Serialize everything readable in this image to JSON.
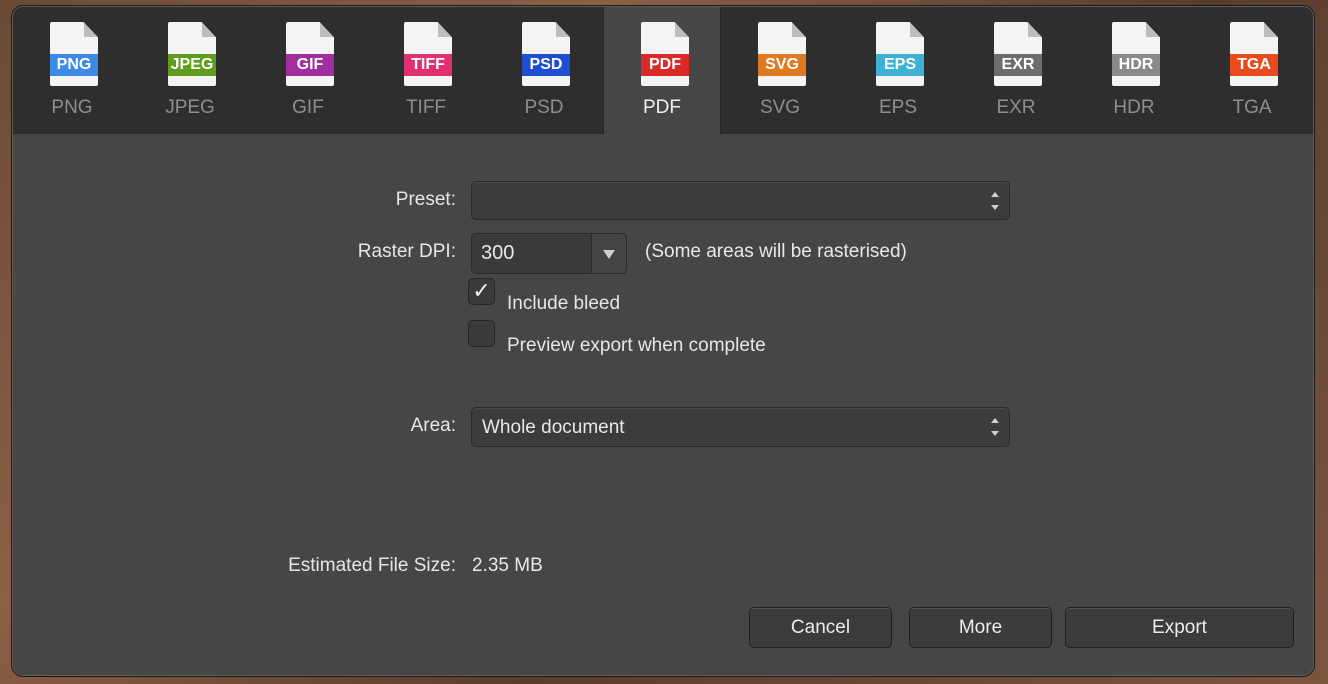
{
  "formats": [
    {
      "tag": "PNG",
      "label": "PNG",
      "color": "#3d8ae6"
    },
    {
      "tag": "JPEG",
      "label": "JPEG",
      "color": "#5f9c1f"
    },
    {
      "tag": "GIF",
      "label": "GIF",
      "color": "#a02e9e"
    },
    {
      "tag": "TIFF",
      "label": "TIFF",
      "color": "#e0306f"
    },
    {
      "tag": "PSD",
      "label": "PSD",
      "color": "#1f4fcf"
    },
    {
      "tag": "PDF",
      "label": "PDF",
      "color": "#d92a28"
    },
    {
      "tag": "SVG",
      "label": "SVG",
      "color": "#e07a20"
    },
    {
      "tag": "EPS",
      "label": "EPS",
      "color": "#3fb0d6"
    },
    {
      "tag": "EXR",
      "label": "EXR",
      "color": "#6d6d6d"
    },
    {
      "tag": "HDR",
      "label": "HDR",
      "color": "#8a8a8a"
    },
    {
      "tag": "TGA",
      "label": "TGA",
      "color": "#e84c1c"
    }
  ],
  "selected_format": "PDF",
  "form": {
    "preset_label": "Preset:",
    "preset_value": "",
    "raster_dpi_label": "Raster DPI:",
    "raster_dpi_value": "300",
    "raster_note": "(Some areas will be rasterised)",
    "include_bleed_label": "Include bleed",
    "include_bleed_checked": true,
    "check_glyph": "✓",
    "preview_label": "Preview export when complete",
    "preview_checked": false,
    "area_label": "Area:",
    "area_value": "Whole document",
    "size_label": "Estimated File Size:",
    "size_value": "2.35 MB"
  },
  "buttons": {
    "cancel": "Cancel",
    "more": "More",
    "export": "Export"
  }
}
